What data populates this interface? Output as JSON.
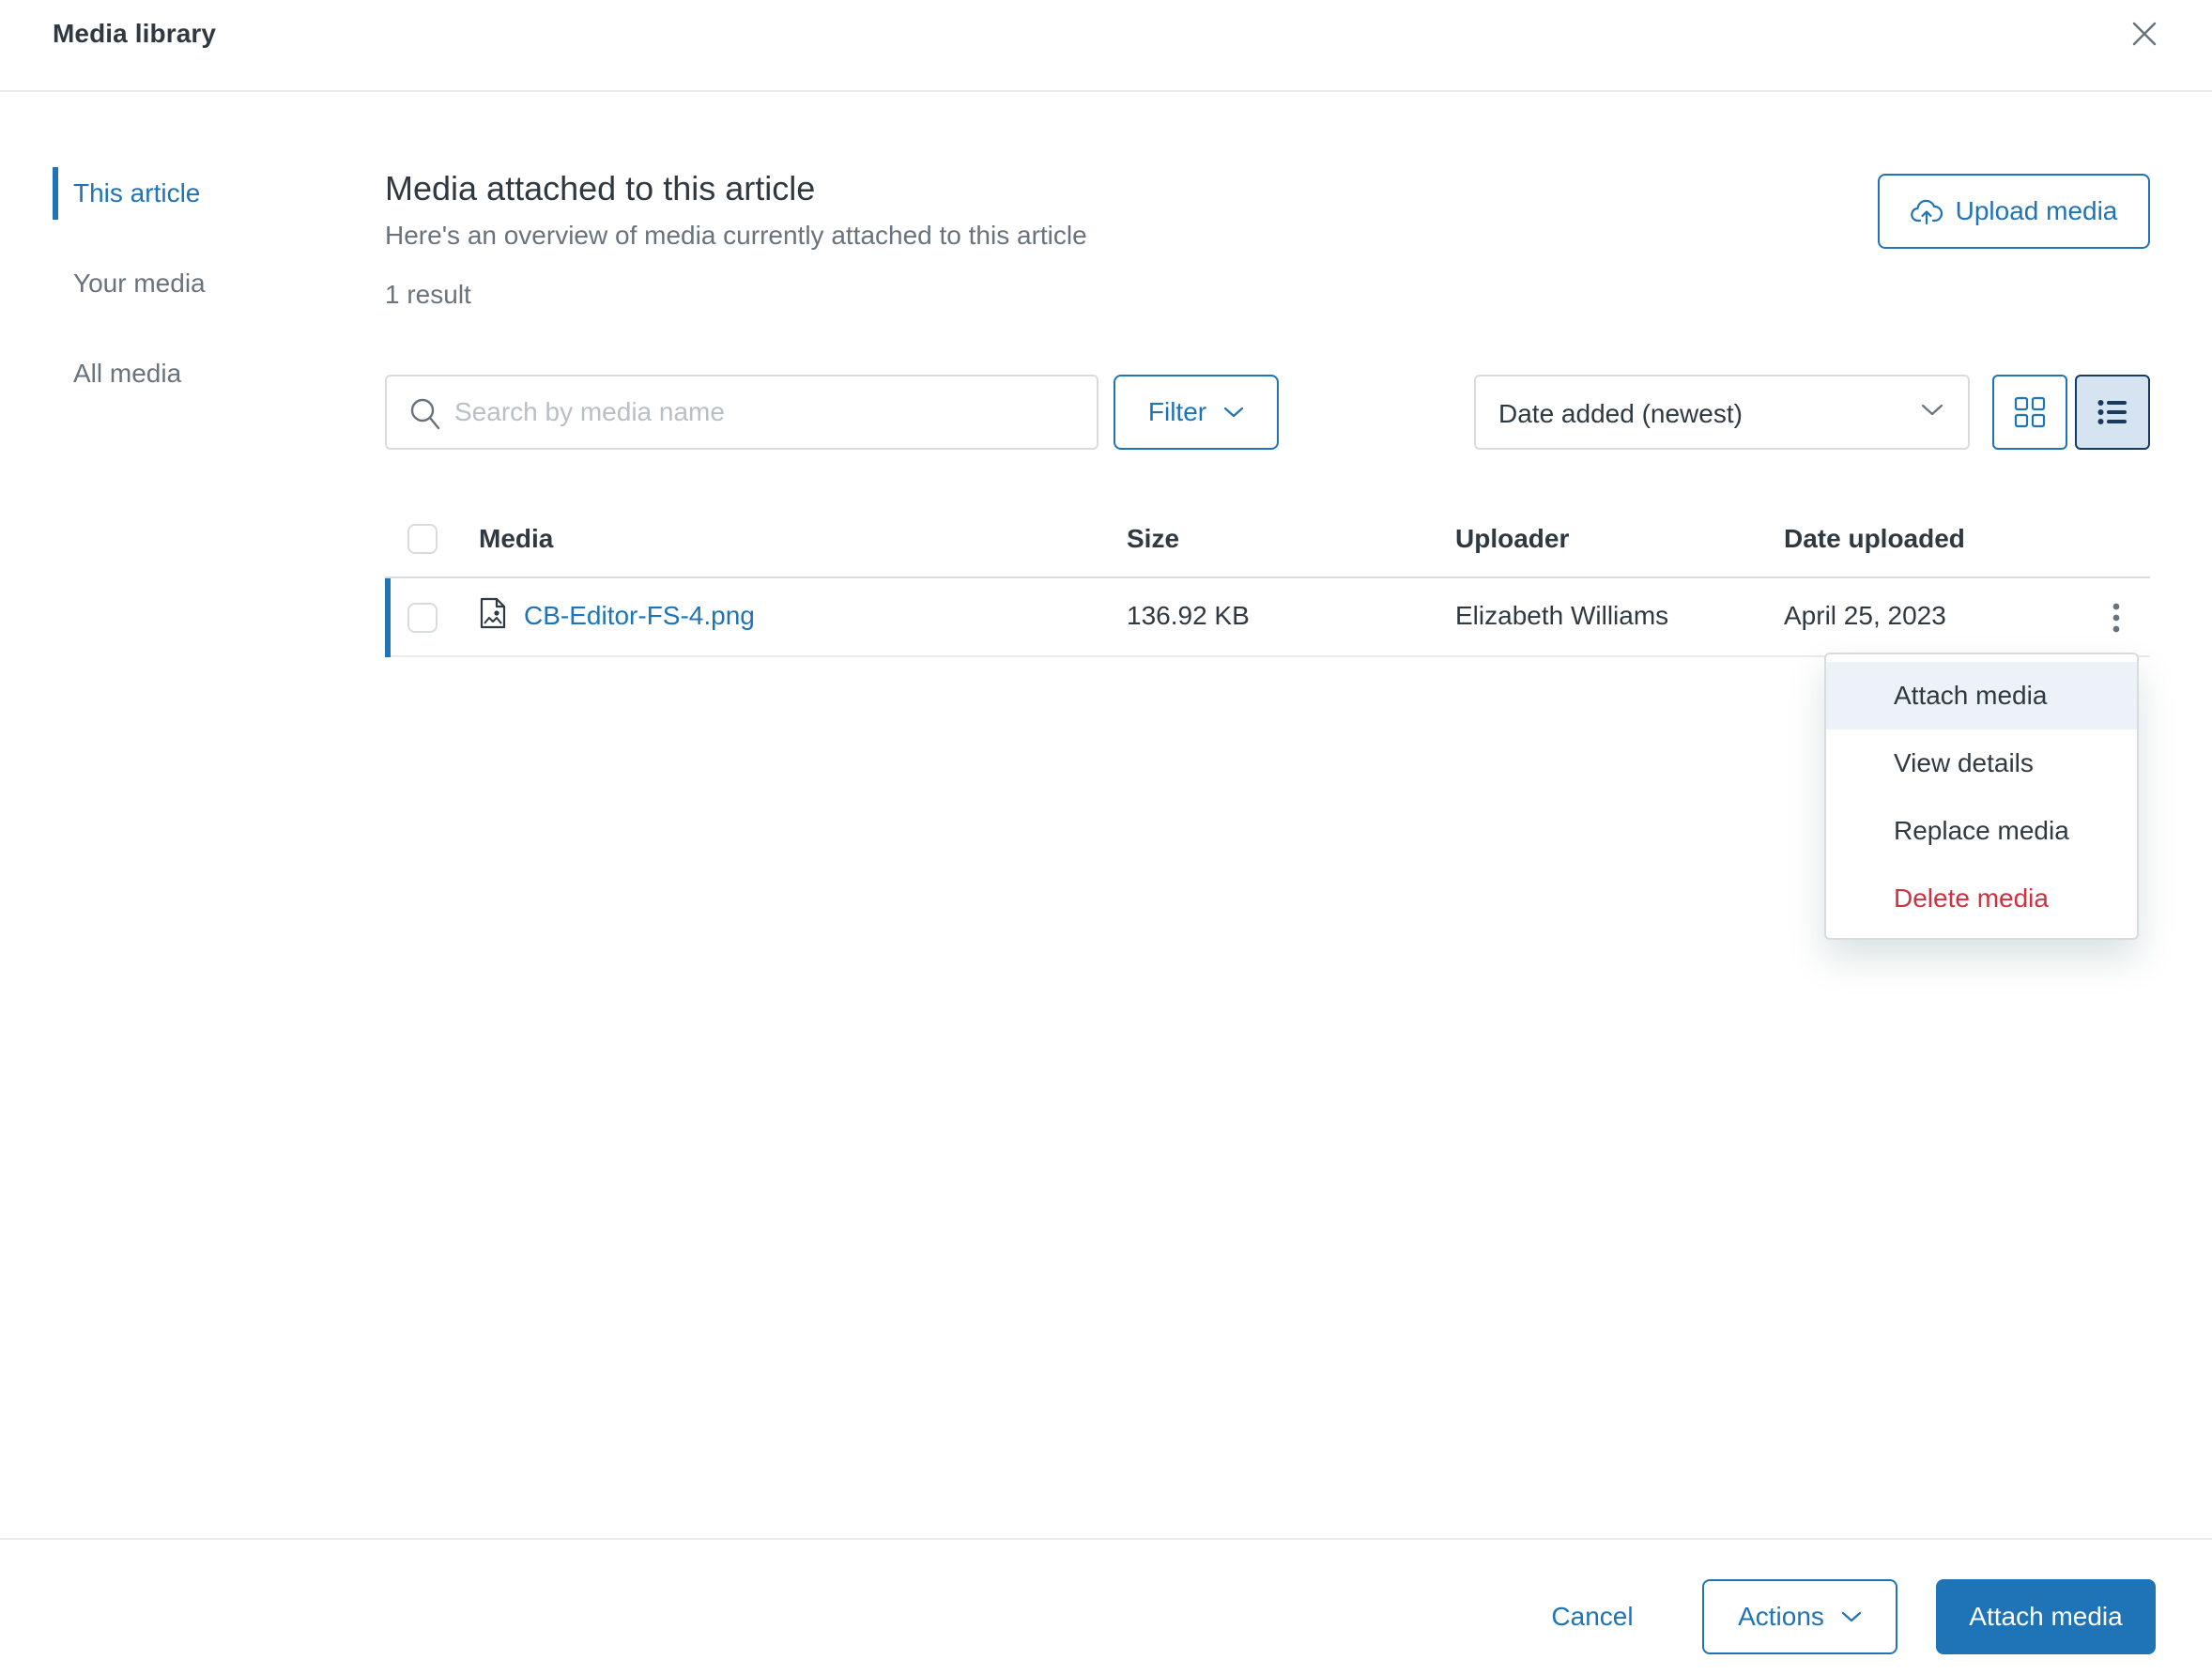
{
  "header": {
    "title": "Media library",
    "close_icon": "close-icon"
  },
  "sidebar": {
    "items": [
      {
        "label": "This article",
        "active": true
      },
      {
        "label": "Your media",
        "active": false
      },
      {
        "label": "All media",
        "active": false
      }
    ]
  },
  "main": {
    "title": "Media attached to this article",
    "subtitle": "Here's an overview of media currently attached to this article",
    "result_count": "1 result",
    "upload_button": {
      "label": "Upload media",
      "icon": "cloud-upload-icon"
    }
  },
  "toolbar": {
    "search": {
      "placeholder": "Search by media name",
      "value": "",
      "icon": "search-icon"
    },
    "filter_button": {
      "label": "Filter",
      "icon": "chevron-down-icon"
    },
    "sort": {
      "selected": "Date added (newest)",
      "icon": "chevron-down-icon"
    },
    "view_toggle": {
      "grid": {
        "icon": "grid-view-icon",
        "selected": false
      },
      "list": {
        "icon": "list-view-icon",
        "selected": true
      }
    }
  },
  "table": {
    "columns": [
      "Media",
      "Size",
      "Uploader",
      "Date uploaded"
    ],
    "rows": [
      {
        "icon": "image-file-icon",
        "name": "CB-Editor-FS-4.png",
        "size": "136.92 KB",
        "uploader": "Elizabeth Williams",
        "date": "April 25, 2023",
        "checked": false
      }
    ]
  },
  "row_menu": {
    "items": [
      {
        "label": "Attach media",
        "highlighted": true
      },
      {
        "label": "View details"
      },
      {
        "label": "Replace media"
      },
      {
        "label": "Delete media",
        "danger": true
      }
    ]
  },
  "footer": {
    "cancel_label": "Cancel",
    "actions_label": "Actions",
    "primary_label": "Attach media"
  },
  "colors": {
    "accent": "#1f73b7",
    "text": "#2f3941",
    "muted": "#68737d",
    "danger": "#cc3340",
    "border": "#d8dcde",
    "highlight": "#edf2f9"
  }
}
